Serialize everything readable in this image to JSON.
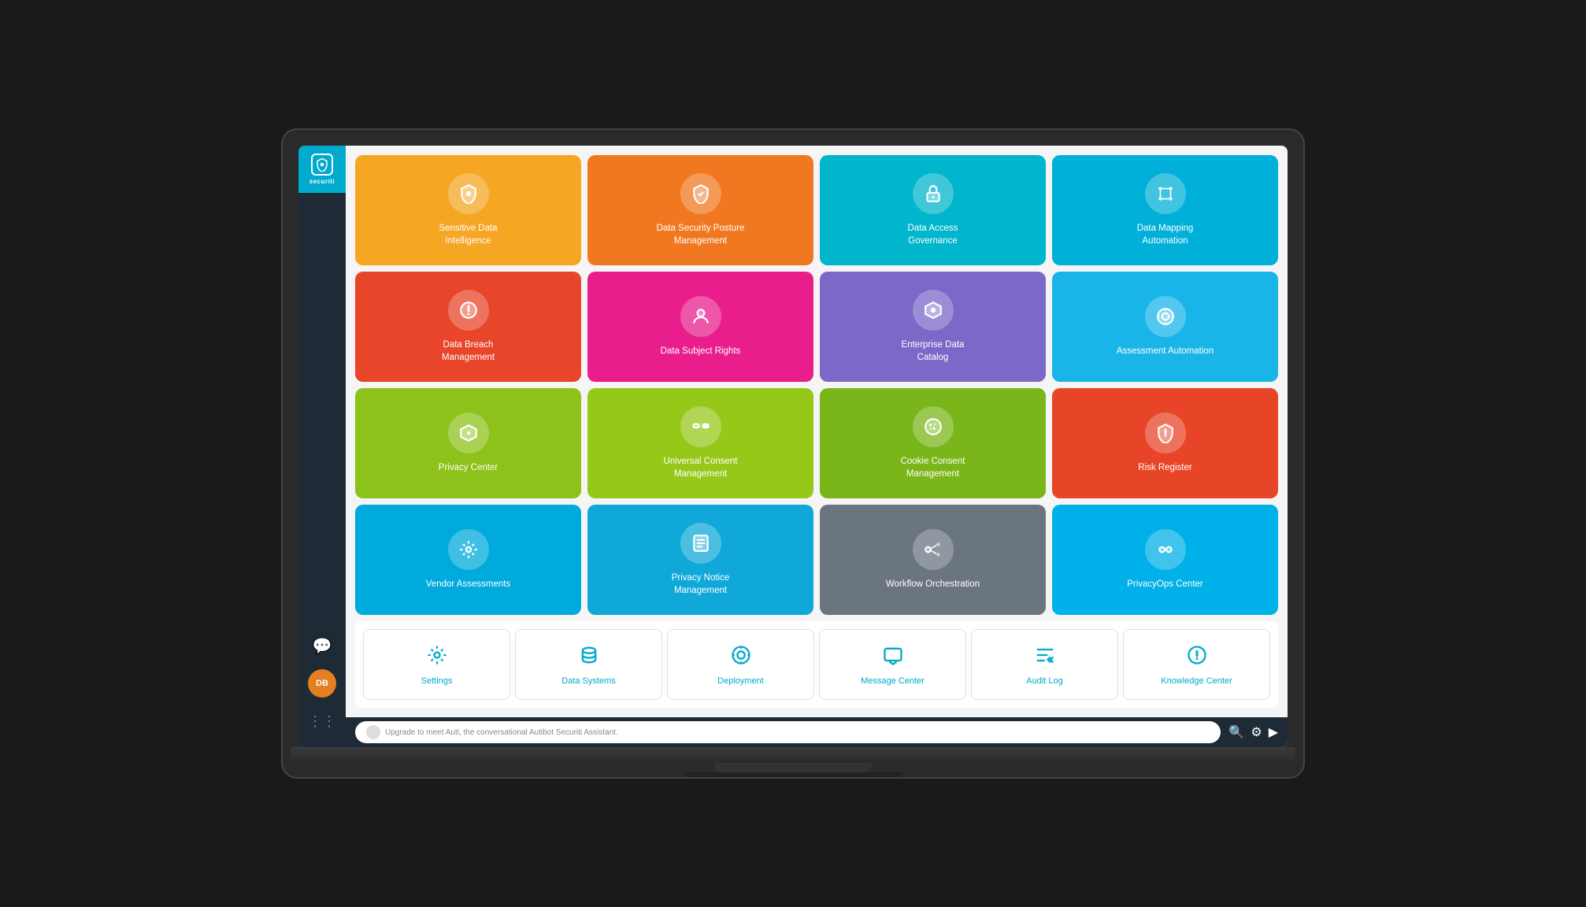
{
  "app": {
    "name": "securiti",
    "logo_text": "securiti"
  },
  "sidebar": {
    "avatar_initials": "DB",
    "icons": [
      "chat",
      "avatar",
      "apps"
    ]
  },
  "tiles": [
    {
      "id": "sensitive-data",
      "label": "Sensitive Data\nIntelligence",
      "color": "tile-orange",
      "icon": "🛡"
    },
    {
      "id": "data-security-posture",
      "label": "Data Security Posture\nManagement",
      "color": "tile-orange2",
      "icon": "🛡"
    },
    {
      "id": "data-access-governance",
      "label": "Data Access\nGovernance",
      "color": "tile-teal",
      "icon": "🔒"
    },
    {
      "id": "data-mapping",
      "label": "Data Mapping\nAutomation",
      "color": "tile-blue-light",
      "icon": "⬡"
    },
    {
      "id": "data-breach",
      "label": "Data Breach\nManagement",
      "color": "tile-red-orange",
      "icon": "📡"
    },
    {
      "id": "data-subject-rights",
      "label": "Data Subject Rights",
      "color": "tile-pink",
      "icon": "⚙"
    },
    {
      "id": "enterprise-data-catalog",
      "label": "Enterprise Data\nCatalog",
      "color": "tile-purple",
      "icon": "⬡"
    },
    {
      "id": "assessment-automation",
      "label": "Assessment Automation",
      "color": "tile-blue2",
      "icon": "©"
    },
    {
      "id": "privacy-center",
      "label": "Privacy Center",
      "color": "tile-green",
      "icon": "⬡"
    },
    {
      "id": "universal-consent",
      "label": "Universal Consent\nManagement",
      "color": "tile-green2",
      "icon": "⊟"
    },
    {
      "id": "cookie-consent",
      "label": "Cookie Consent\nManagement",
      "color": "tile-green3",
      "icon": "⬡"
    },
    {
      "id": "risk-register",
      "label": "Risk Register",
      "color": "tile-red2",
      "icon": "🛡"
    },
    {
      "id": "vendor-assessments",
      "label": "Vendor Assessments",
      "color": "tile-sky",
      "icon": "⚙"
    },
    {
      "id": "privacy-notice",
      "label": "Privacy Notice\nManagement",
      "color": "tile-sky2",
      "icon": "📋"
    },
    {
      "id": "workflow-orchestration",
      "label": "Workflow Orchestration",
      "color": "tile-gray",
      "icon": "⬡"
    },
    {
      "id": "privacyops-center",
      "label": "PrivacyOps Center",
      "color": "tile-sky3",
      "icon": "⊙"
    }
  ],
  "bottom_tiles": [
    {
      "id": "settings",
      "label": "Settings",
      "icon": "⚙"
    },
    {
      "id": "data-systems",
      "label": "Data Systems",
      "icon": "🗄"
    },
    {
      "id": "deployment",
      "label": "Deployment",
      "icon": "⚙"
    },
    {
      "id": "message-center",
      "label": "Message Center",
      "icon": "💬"
    },
    {
      "id": "audit-log",
      "label": "Audit Log",
      "icon": "☰"
    },
    {
      "id": "knowledge-center",
      "label": "Knowledge Center",
      "icon": "?"
    }
  ],
  "footer": {
    "chat_placeholder": "Upgrade to meet Auti, the conversational Autibot Securiti Assistant."
  }
}
